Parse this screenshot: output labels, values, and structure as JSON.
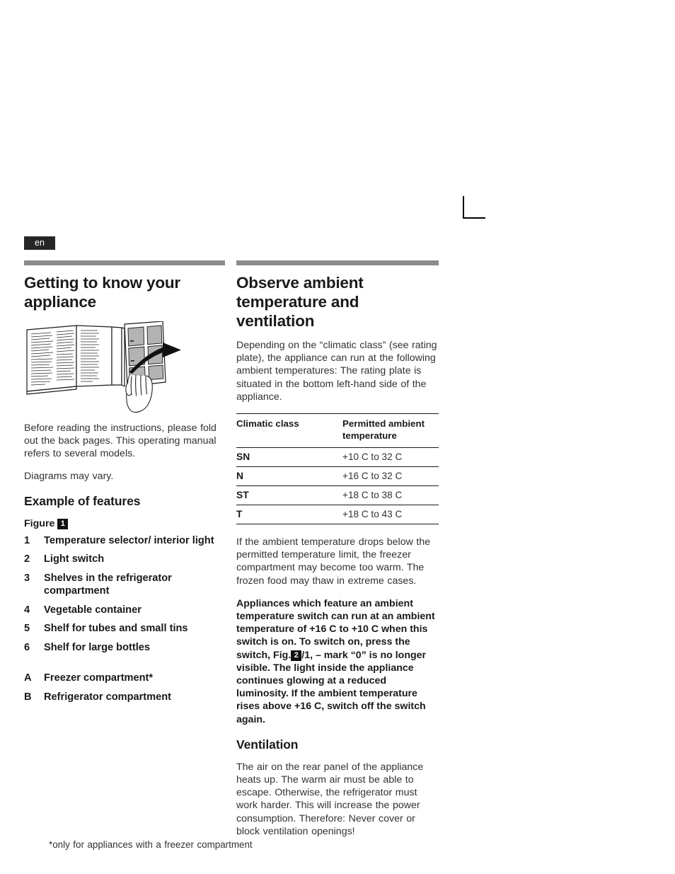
{
  "page": {
    "language_tag": "en",
    "footnote": "*only for appliances with a freezer  compartment"
  },
  "left_column": {
    "heading": "Getting to know your appliance",
    "illustration_caption": "open-manual-foldout-illustration",
    "intro_paragraph": "Before reading the instructions, please fold out the back pages. This operating manual refers to several models.",
    "note_paragraph": "Diagrams may vary.",
    "subheading": "Example of features",
    "figure_label_prefix": "Figure",
    "figure_label_badge": "1",
    "features": [
      {
        "num": "1",
        "label": "Temperature selector/ interior light"
      },
      {
        "num": "2",
        "label": "Light switch"
      },
      {
        "num": "3",
        "label": "Shelves in the refrigerator compartment"
      },
      {
        "num": "4",
        "label": "Vegetable container"
      },
      {
        "num": "5",
        "label": "Shelf for tubes and small tins"
      },
      {
        "num": "6",
        "label": "Shelf for large bottles"
      }
    ],
    "compartments": [
      {
        "num": "A",
        "label": "Freezer compartment*"
      },
      {
        "num": "B",
        "label": "Refrigerator compartment"
      }
    ]
  },
  "right_column": {
    "heading": "Observe ambient temperature and ventilation",
    "intro_paragraph": "Depending on the “climatic class” (see rating plate), the appliance can run at the following ambient temperatures: The rating plate is situated in the bottom left-hand side of the appliance.",
    "table": {
      "headers": [
        "Climatic class",
        "Permitted ambient temperature"
      ],
      "rows": [
        {
          "climatic_class": "SN",
          "permitted_temperature": "+10  C to 32  C"
        },
        {
          "climatic_class": "N",
          "permitted_temperature": "+16  C to 32  C"
        },
        {
          "climatic_class": "ST",
          "permitted_temperature": "+18  C to 38  C"
        },
        {
          "climatic_class": "T",
          "permitted_temperature": "+18  C to 43  C"
        }
      ]
    },
    "after_table_paragraph": "If the ambient temperature drops below the permitted temperature limit, the freezer compartment may become too warm. The frozen food may thaw in extreme cases.",
    "bold_paragraph_part1": "Appliances which feature an ambient temperature switch can run at an ambient temperature of +16  C to +10  C when this switch is on. To switch on, press the switch, Fig.",
    "bold_paragraph_badge": "2",
    "bold_paragraph_part2": "/1, – mark “0” is no longer visible. The light inside the appliance continues glowing at a reduced luminosity. If the ambient temperature rises above +16  C, switch off the switch again.",
    "ventilation_heading": "Ventilation",
    "ventilation_paragraph": "The air on the rear panel of the appliance heats up. The warm air must be able to escape. Otherwise, the refrigerator must work harder. This will increase the power consumption. Therefore: Never cover or block ventilation openings!"
  },
  "colors": {
    "rule_bar": "#8c8c8c",
    "tag_background": "#262626",
    "text": "#1a1a1a",
    "body_text": "#333333",
    "panel_fill": "#b3b3b3"
  }
}
